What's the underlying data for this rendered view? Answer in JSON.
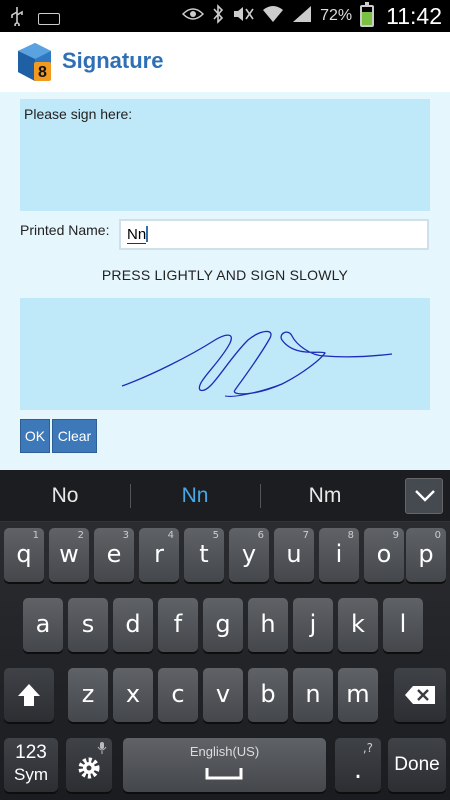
{
  "status_bar": {
    "battery_percent": "72%",
    "time": "11:42",
    "icons": [
      "usb-icon",
      "keyboard-icon",
      "eye-icon",
      "bluetooth-icon",
      "mute-icon",
      "wifi-icon",
      "signal-icon",
      "battery-icon"
    ]
  },
  "app": {
    "title": "Signature",
    "logo_text": "8"
  },
  "form": {
    "instruction": "Please sign here:",
    "printed_name_label": "Printed Name:",
    "printed_name_value": "Nn",
    "press_instruction": "PRESS LIGHTLY AND SIGN SLOWLY",
    "ok_label": "OK",
    "clear_label": "Clear"
  },
  "keyboard": {
    "suggestions": [
      "No",
      "Nn",
      "Nm"
    ],
    "row1": [
      {
        "k": "q",
        "s": "1"
      },
      {
        "k": "w",
        "s": "2"
      },
      {
        "k": "e",
        "s": "3"
      },
      {
        "k": "r",
        "s": "4"
      },
      {
        "k": "t",
        "s": "5"
      },
      {
        "k": "y",
        "s": "6"
      },
      {
        "k": "u",
        "s": "7"
      },
      {
        "k": "i",
        "s": "8"
      },
      {
        "k": "o",
        "s": "9"
      },
      {
        "k": "p",
        "s": "0"
      }
    ],
    "row2": [
      "a",
      "s",
      "d",
      "f",
      "g",
      "h",
      "j",
      "k",
      "l"
    ],
    "row3": [
      "z",
      "x",
      "c",
      "v",
      "b",
      "n",
      "m"
    ],
    "sym_line1": "123",
    "sym_line2": "Sym",
    "space_label": "English(US)",
    "period": ".",
    "period_sub": ",?",
    "done_label": "Done"
  },
  "colors": {
    "accent": "#2f6fb5",
    "pad_background": "#bfe8f9",
    "content_background": "#e5f6fd",
    "signature_ink": "#1d2bb8",
    "suggestion_highlight": "#49a7e6"
  }
}
